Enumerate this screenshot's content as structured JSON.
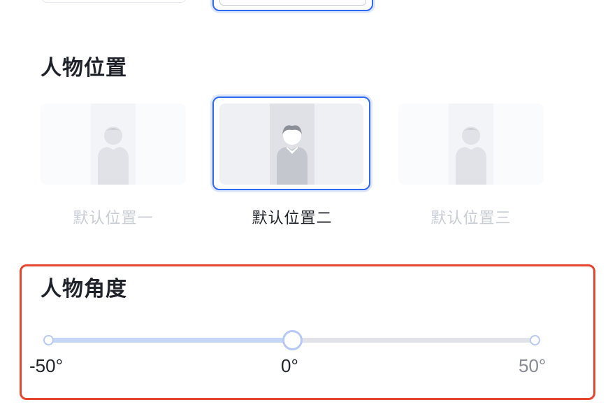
{
  "previous_section": {},
  "position_section": {
    "title": "人物位置",
    "options": [
      {
        "label": "默认位置一",
        "selected": false
      },
      {
        "label": "默认位置二",
        "selected": true
      },
      {
        "label": "默认位置三",
        "selected": false
      }
    ]
  },
  "angle_section": {
    "title": "人物角度",
    "slider": {
      "min_label": "-50°",
      "mid_label": "0°",
      "max_label": "50°",
      "value": 0,
      "min": -50,
      "max": 50
    }
  },
  "colors": {
    "accent": "#2f6bf0",
    "highlight": "#e5442f",
    "slider_fill": "#c6d6f7",
    "slider_track": "#e1e3e8"
  },
  "icons": [
    "person-silhouette-icon"
  ]
}
